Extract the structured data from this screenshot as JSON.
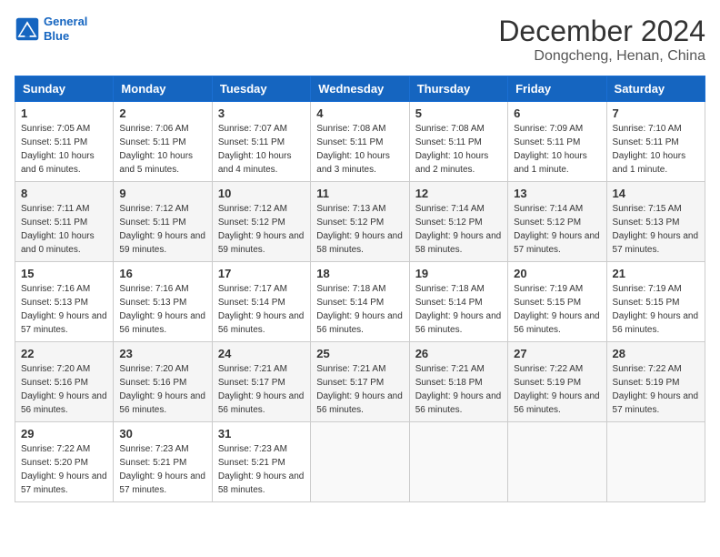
{
  "logo": {
    "line1": "General",
    "line2": "Blue"
  },
  "title": "December 2024",
  "subtitle": "Dongcheng, Henan, China",
  "days_of_week": [
    "Sunday",
    "Monday",
    "Tuesday",
    "Wednesday",
    "Thursday",
    "Friday",
    "Saturday"
  ],
  "weeks": [
    [
      {
        "day": "1",
        "sunrise": "7:05 AM",
        "sunset": "5:11 PM",
        "daylight": "10 hours and 6 minutes."
      },
      {
        "day": "2",
        "sunrise": "7:06 AM",
        "sunset": "5:11 PM",
        "daylight": "10 hours and 5 minutes."
      },
      {
        "day": "3",
        "sunrise": "7:07 AM",
        "sunset": "5:11 PM",
        "daylight": "10 hours and 4 minutes."
      },
      {
        "day": "4",
        "sunrise": "7:08 AM",
        "sunset": "5:11 PM",
        "daylight": "10 hours and 3 minutes."
      },
      {
        "day": "5",
        "sunrise": "7:08 AM",
        "sunset": "5:11 PM",
        "daylight": "10 hours and 2 minutes."
      },
      {
        "day": "6",
        "sunrise": "7:09 AM",
        "sunset": "5:11 PM",
        "daylight": "10 hours and 1 minute."
      },
      {
        "day": "7",
        "sunrise": "7:10 AM",
        "sunset": "5:11 PM",
        "daylight": "10 hours and 1 minute."
      }
    ],
    [
      {
        "day": "8",
        "sunrise": "7:11 AM",
        "sunset": "5:11 PM",
        "daylight": "10 hours and 0 minutes."
      },
      {
        "day": "9",
        "sunrise": "7:12 AM",
        "sunset": "5:11 PM",
        "daylight": "9 hours and 59 minutes."
      },
      {
        "day": "10",
        "sunrise": "7:12 AM",
        "sunset": "5:12 PM",
        "daylight": "9 hours and 59 minutes."
      },
      {
        "day": "11",
        "sunrise": "7:13 AM",
        "sunset": "5:12 PM",
        "daylight": "9 hours and 58 minutes."
      },
      {
        "day": "12",
        "sunrise": "7:14 AM",
        "sunset": "5:12 PM",
        "daylight": "9 hours and 58 minutes."
      },
      {
        "day": "13",
        "sunrise": "7:14 AM",
        "sunset": "5:12 PM",
        "daylight": "9 hours and 57 minutes."
      },
      {
        "day": "14",
        "sunrise": "7:15 AM",
        "sunset": "5:13 PM",
        "daylight": "9 hours and 57 minutes."
      }
    ],
    [
      {
        "day": "15",
        "sunrise": "7:16 AM",
        "sunset": "5:13 PM",
        "daylight": "9 hours and 57 minutes."
      },
      {
        "day": "16",
        "sunrise": "7:16 AM",
        "sunset": "5:13 PM",
        "daylight": "9 hours and 56 minutes."
      },
      {
        "day": "17",
        "sunrise": "7:17 AM",
        "sunset": "5:14 PM",
        "daylight": "9 hours and 56 minutes."
      },
      {
        "day": "18",
        "sunrise": "7:18 AM",
        "sunset": "5:14 PM",
        "daylight": "9 hours and 56 minutes."
      },
      {
        "day": "19",
        "sunrise": "7:18 AM",
        "sunset": "5:14 PM",
        "daylight": "9 hours and 56 minutes."
      },
      {
        "day": "20",
        "sunrise": "7:19 AM",
        "sunset": "5:15 PM",
        "daylight": "9 hours and 56 minutes."
      },
      {
        "day": "21",
        "sunrise": "7:19 AM",
        "sunset": "5:15 PM",
        "daylight": "9 hours and 56 minutes."
      }
    ],
    [
      {
        "day": "22",
        "sunrise": "7:20 AM",
        "sunset": "5:16 PM",
        "daylight": "9 hours and 56 minutes."
      },
      {
        "day": "23",
        "sunrise": "7:20 AM",
        "sunset": "5:16 PM",
        "daylight": "9 hours and 56 minutes."
      },
      {
        "day": "24",
        "sunrise": "7:21 AM",
        "sunset": "5:17 PM",
        "daylight": "9 hours and 56 minutes."
      },
      {
        "day": "25",
        "sunrise": "7:21 AM",
        "sunset": "5:17 PM",
        "daylight": "9 hours and 56 minutes."
      },
      {
        "day": "26",
        "sunrise": "7:21 AM",
        "sunset": "5:18 PM",
        "daylight": "9 hours and 56 minutes."
      },
      {
        "day": "27",
        "sunrise": "7:22 AM",
        "sunset": "5:19 PM",
        "daylight": "9 hours and 56 minutes."
      },
      {
        "day": "28",
        "sunrise": "7:22 AM",
        "sunset": "5:19 PM",
        "daylight": "9 hours and 57 minutes."
      }
    ],
    [
      {
        "day": "29",
        "sunrise": "7:22 AM",
        "sunset": "5:20 PM",
        "daylight": "9 hours and 57 minutes."
      },
      {
        "day": "30",
        "sunrise": "7:23 AM",
        "sunset": "5:21 PM",
        "daylight": "9 hours and 57 minutes."
      },
      {
        "day": "31",
        "sunrise": "7:23 AM",
        "sunset": "5:21 PM",
        "daylight": "9 hours and 58 minutes."
      },
      null,
      null,
      null,
      null
    ]
  ]
}
